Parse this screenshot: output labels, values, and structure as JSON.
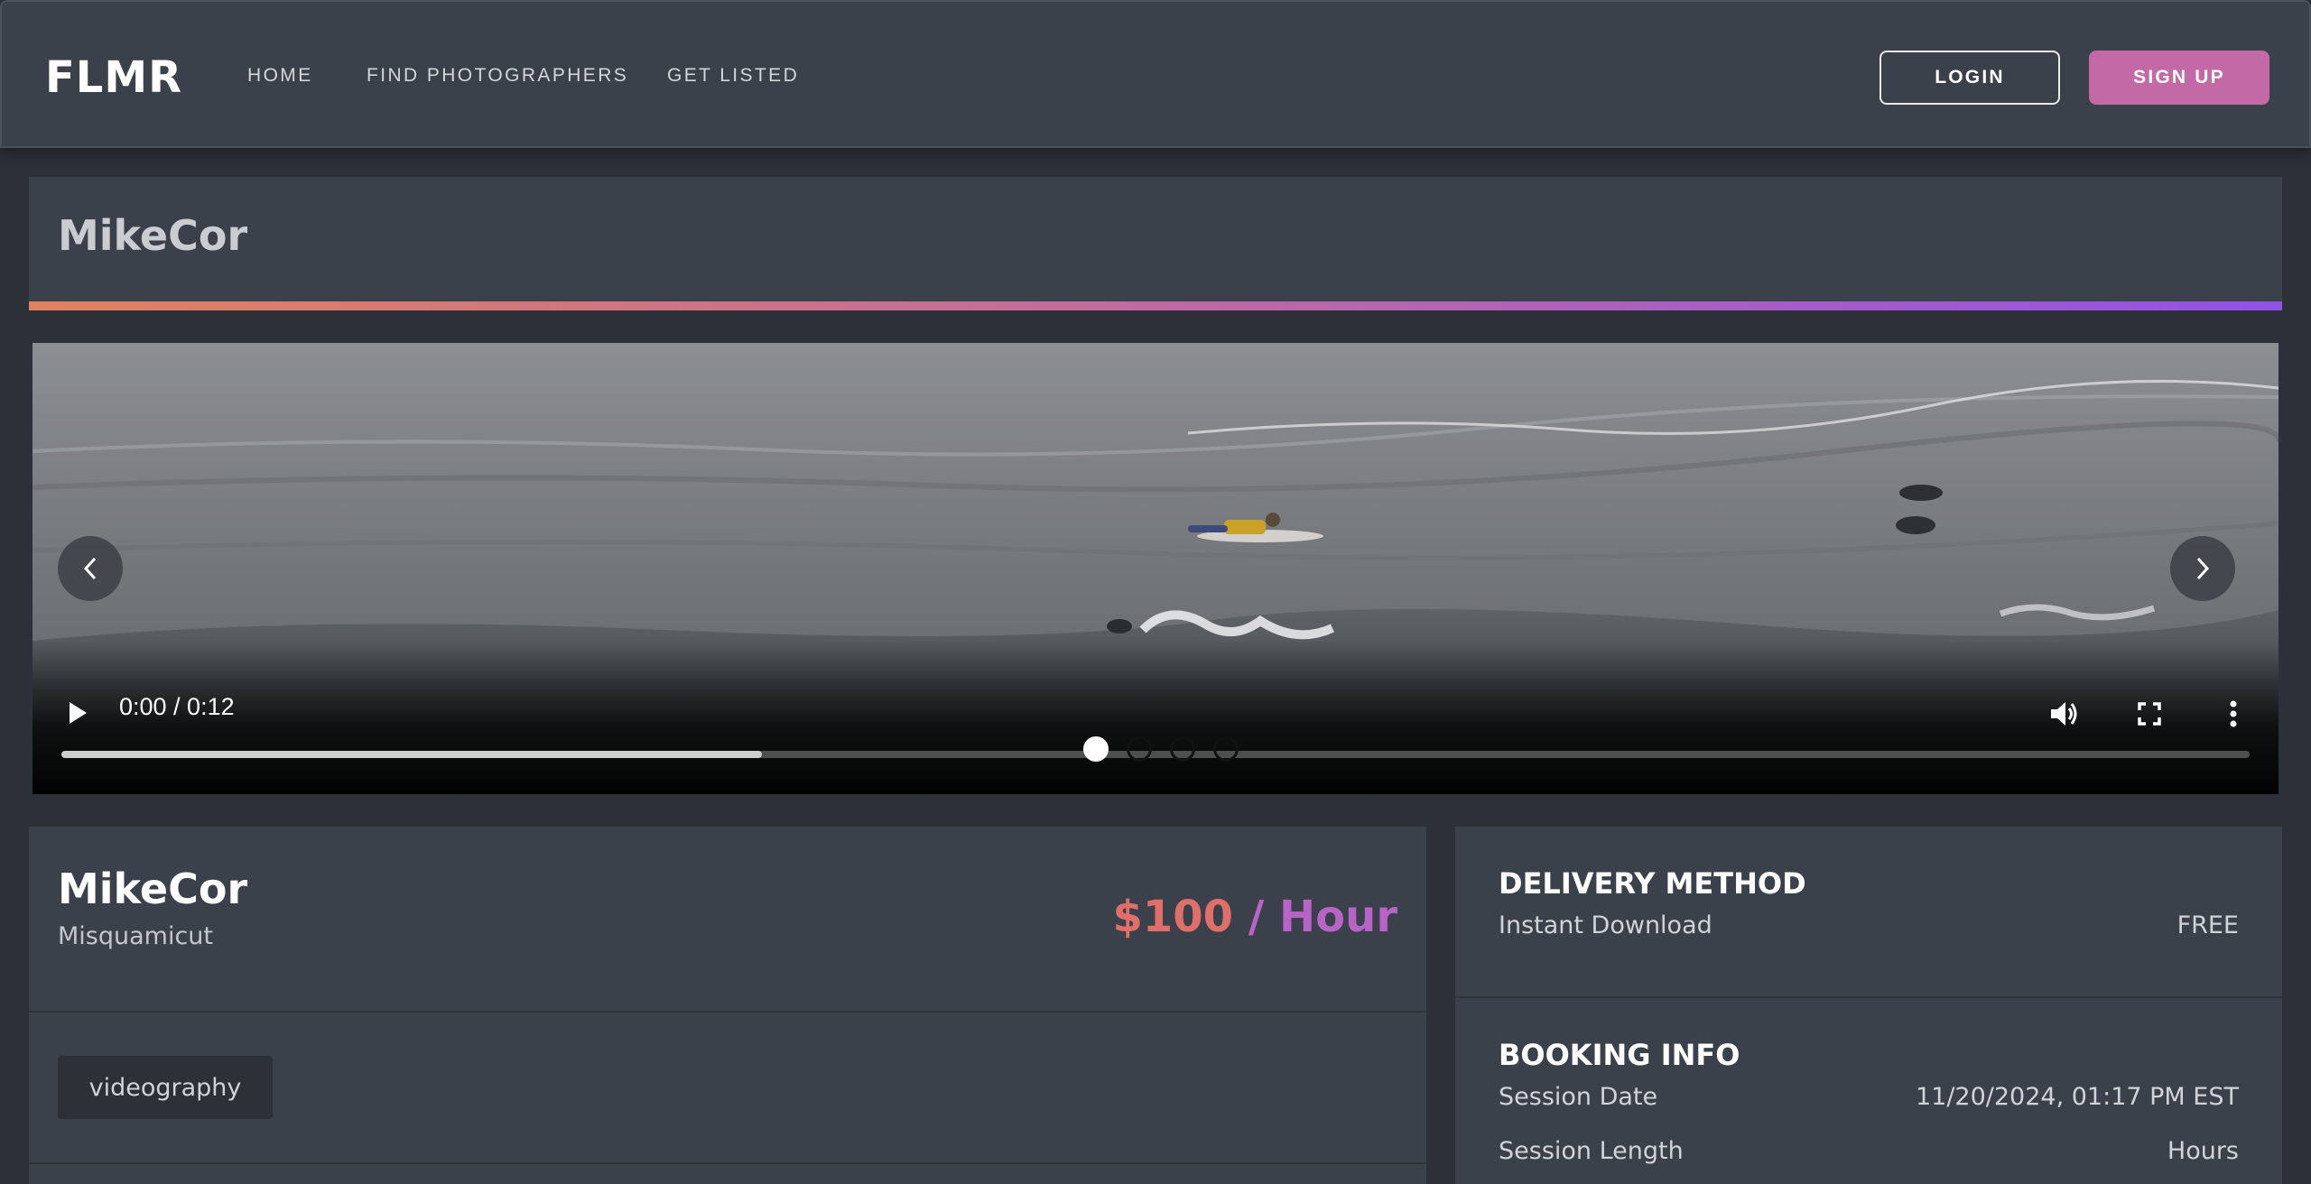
{
  "header": {
    "logo": "FLMR",
    "nav": [
      "HOME",
      "FIND PHOTOGRAPHERS",
      "GET LISTED"
    ],
    "login_label": "LOGIN",
    "signup_label": "SIGN UP"
  },
  "listing": {
    "title": "MikeCor"
  },
  "video": {
    "current_time": "0:00",
    "duration": "0:12",
    "time_display": "0:00 / 0:12",
    "buffered_fraction": 0.32,
    "slides_count": 4,
    "active_slide": 0
  },
  "info": {
    "name": "MikeCor",
    "location": "Misquamicut",
    "price_amount": "$100",
    "price_separator": " / ",
    "price_unit": "Hour",
    "tags": [
      "videography"
    ]
  },
  "delivery": {
    "heading": "DELIVERY METHOD",
    "method": "Instant Download",
    "cost": "FREE"
  },
  "booking": {
    "heading": "BOOKING INFO",
    "session_date_label": "Session Date",
    "session_date_value": "11/20/2024, 01:17 PM EST",
    "session_length_label": "Session Length",
    "session_length_value": "Hours"
  },
  "colors": {
    "page_bg": "#2c3038",
    "card_bg": "#3b414a",
    "signup_bg": "#c36aa6",
    "gradient": [
      "#e0825e",
      "#c06aa0",
      "#9152e6"
    ],
    "price_amount": "#e06f6a",
    "price_unit": "#b764c6"
  }
}
